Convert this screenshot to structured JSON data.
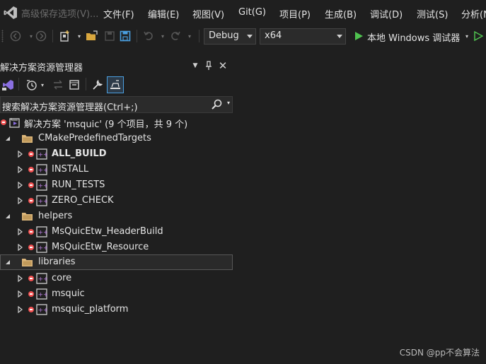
{
  "window": {
    "title": "高级保存选项(V)...",
    "menu": [
      "文件(F)",
      "编辑(E)",
      "视图(V)",
      "Git(G)",
      "项目(P)",
      "生成(B)",
      "调试(D)",
      "测试(S)",
      "分析(N"
    ]
  },
  "toolbar": {
    "configuration": "Debug",
    "platform": "x64",
    "run_target": "本地 Windows 调试器"
  },
  "solution_explorer": {
    "title": "解决方案资源管理器",
    "search_placeholder": "搜索解决方案资源管理器(Ctrl+;)",
    "solution_label": "解决方案 'msquic' (9 个项目，共 9 个)",
    "folders": [
      {
        "name": "CMakePredefinedTargets",
        "projects": [
          "ALL_BUILD",
          "INSTALL",
          "RUN_TESTS",
          "ZERO_CHECK"
        ]
      },
      {
        "name": "helpers",
        "projects": [
          "MsQuicEtw_HeaderBuild",
          "MsQuicEtw_Resource"
        ]
      },
      {
        "name": "libraries",
        "projects": [
          "core",
          "msquic",
          "msquic_platform"
        ]
      }
    ]
  },
  "watermark": "CSDN @pp不会算法"
}
